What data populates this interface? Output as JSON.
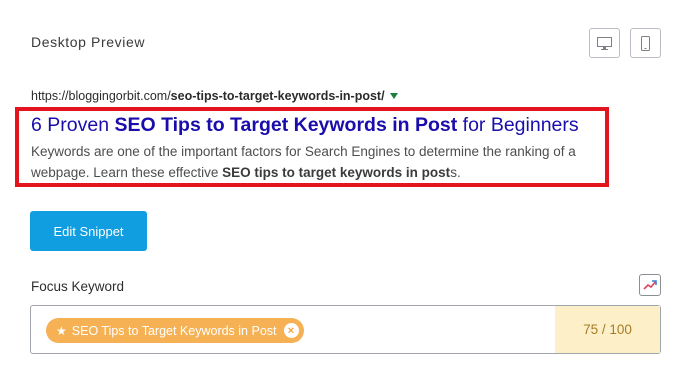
{
  "preview": {
    "heading": "Desktop Preview",
    "device_buttons": [
      {
        "name": "desktop",
        "icon": "desktop-icon"
      },
      {
        "name": "mobile",
        "icon": "mobile-icon"
      }
    ]
  },
  "serp": {
    "url_base": "https://bloggingorbit.com/",
    "url_path": "seo-tips-to-target-keywords-in-post/",
    "title_prefix": "6 Proven ",
    "title_keyword": "SEO Tips to Target Keywords in Post",
    "title_suffix": " for Beginners",
    "desc_start": "Keywords are one of the important factors for Search Engines to determine the ranking of a webpage. Learn these effective ",
    "desc_keyword": "SEO tips to target keywords in post",
    "desc_end": "s.",
    "colors": {
      "title": "#1a0dab",
      "url_caret": "#1a7f3c",
      "highlight": "#e3141d"
    }
  },
  "actions": {
    "edit_snippet_label": "Edit Snippet",
    "button_color": "#109ee0"
  },
  "focus_keyword": {
    "label": "Focus Keyword",
    "chip_text": "SEO Tips to Target Keywords in Post",
    "chip_color": "#f6b154",
    "score": "75 / 100",
    "trend_icon": "trending-chart-icon"
  }
}
